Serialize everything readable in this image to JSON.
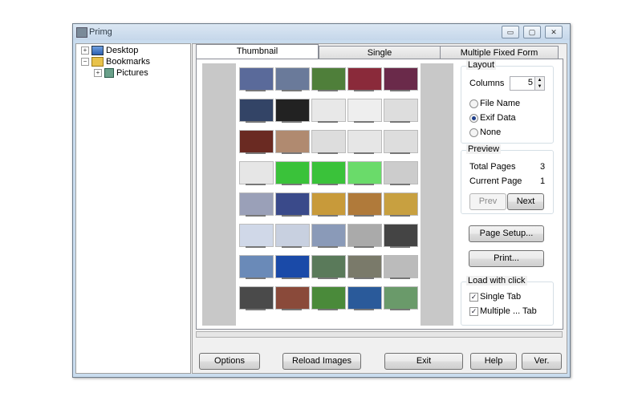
{
  "window": {
    "title": "Primg",
    "min_glyph": "▭",
    "max_glyph": "▢",
    "close_glyph": "✕"
  },
  "tree": [
    {
      "label": "Desktop",
      "expander": "+"
    },
    {
      "label": "Bookmarks",
      "expander": "−"
    },
    {
      "label": "Pictures",
      "expander": "+"
    }
  ],
  "tabs": [
    "Thumbnail",
    "Single",
    "Multiple Fixed Form"
  ],
  "layout": {
    "title": "Layout",
    "columns_label": "Columns",
    "columns_value": "5",
    "options": [
      "File Name",
      "Exif Data",
      "None"
    ],
    "selected": "Exif Data"
  },
  "preview": {
    "title": "Preview",
    "total_pages_label": "Total Pages",
    "total_pages": "3",
    "current_page_label": "Current Page",
    "current_page": "1",
    "prev": "Prev",
    "next": "Next"
  },
  "page_setup": "Page Setup...",
  "print": "Print...",
  "load_with_click": {
    "title": "Load with click",
    "single_tab": "Single Tab",
    "multiple_tab": "Multiple ... Tab",
    "single_checked": true,
    "multiple_checked": true
  },
  "bottom_buttons": [
    "Options",
    "Reload Images",
    "Exit",
    "Help",
    "Ver."
  ],
  "thumb_colors": [
    "#5a6a9a",
    "#6a7a9a",
    "#4f7f3a",
    "#8a2a3a",
    "#6a2a4a",
    "#334466",
    "#222222",
    "#e8e8e8",
    "#eeeeee",
    "#dddddd",
    "#6a2a22",
    "#b08a70",
    "#dddddd",
    "#e6e6e6",
    "#dddddd",
    "#e6e6e6",
    "#3ac23a",
    "#3ac23a",
    "#6adb6a",
    "#cccccc",
    "#9aa0b8",
    "#3a4a8a",
    "#c89a3a",
    "#b07a3a",
    "#c8a040",
    "#d0d8e8",
    "#c8d0e0",
    "#8a9ab8",
    "#aaaaaa",
    "#444444",
    "#6a8ab8",
    "#1a4aa8",
    "#5a7a5a",
    "#7a7a6a",
    "#bbbbbb",
    "#4a4a4a",
    "#8a4a3a",
    "#4a8a3a",
    "#2a5a9a",
    "#6a9a6a"
  ]
}
